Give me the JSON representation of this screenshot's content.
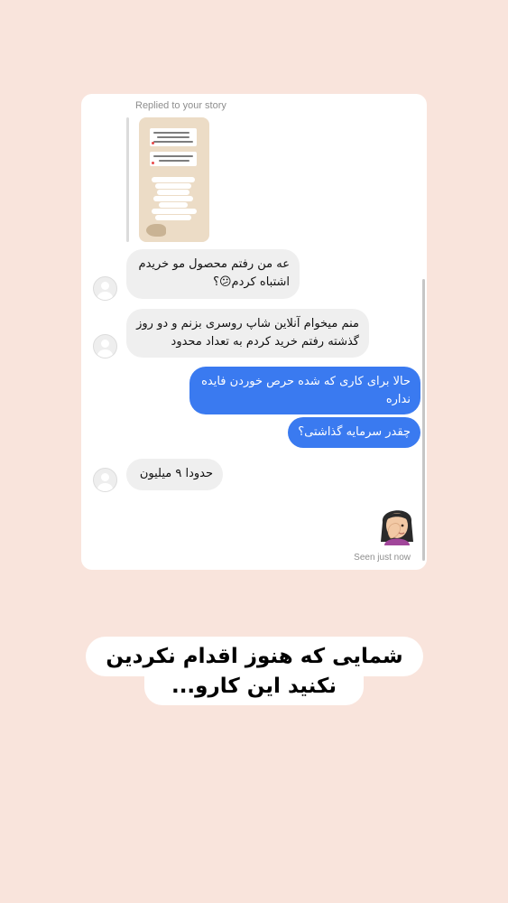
{
  "dm": {
    "reply_label": "Replied to your story",
    "messages": [
      {
        "from": "them",
        "text": "عه من رفتم محصول مو خریدم اشتباه کردم😕؟"
      },
      {
        "from": "them",
        "text": "منم میخوام آنلاین شاپ روسری بزنم و دو روز گذشته رفتم خرید کردم به تعداد محدود"
      },
      {
        "from": "me",
        "text": "حالا برای کاری که شده حرص خوردن فایده نداره"
      },
      {
        "from": "me",
        "text": "چقدر سرمایه گذاشتی؟"
      },
      {
        "from": "them",
        "text": "حدودا ۹ میلیون"
      }
    ],
    "seen_text": "Seen just now"
  },
  "caption": {
    "line1": "شمایی که هنوز اقدام نکردین",
    "line2": "نکنید این کارو..."
  },
  "colors": {
    "background": "#f9e4dc",
    "outgoing_bubble": "#3a7af0",
    "incoming_bubble": "#efefef"
  },
  "icons": [
    "default-avatar-icon",
    "face-palm-memoji-icon"
  ]
}
